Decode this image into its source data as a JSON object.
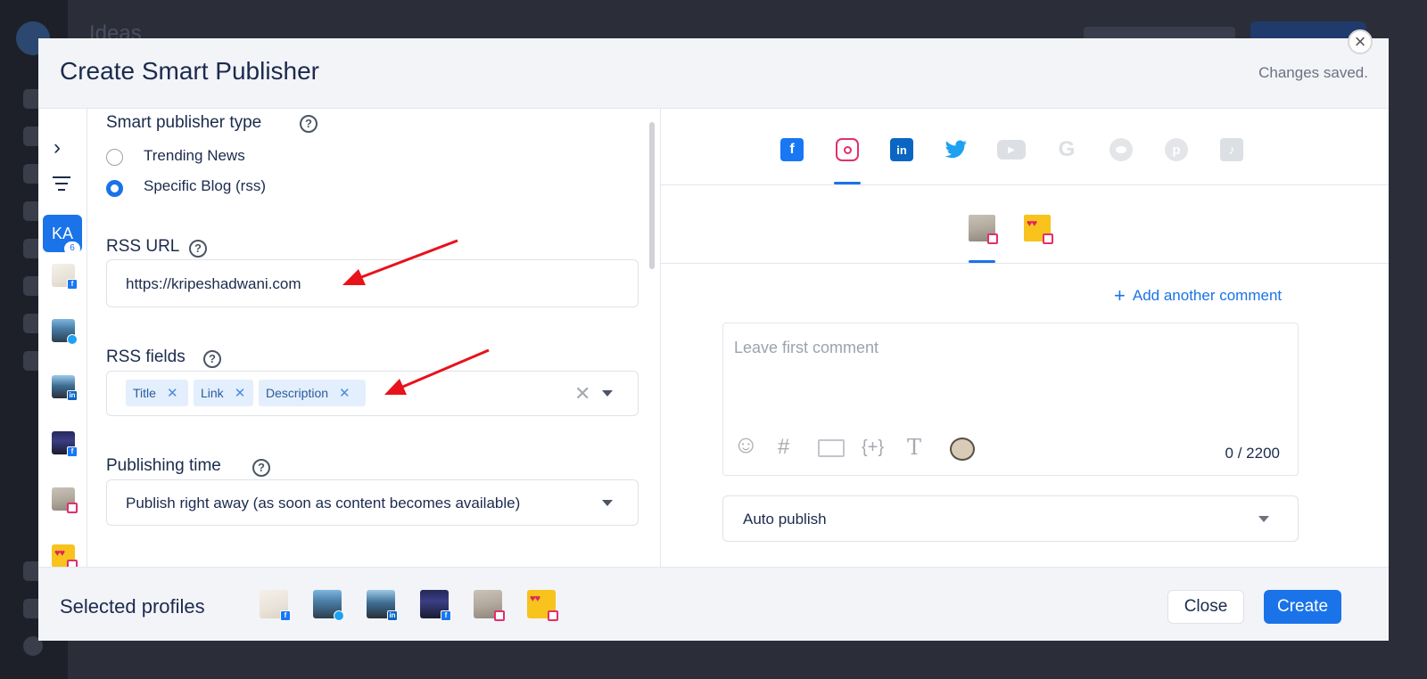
{
  "background": {
    "page_title": "Ideas"
  },
  "modal": {
    "title": "Create Smart Publisher",
    "status": "Changes saved.",
    "close_icon": "×"
  },
  "rail": {
    "chevron": "›",
    "workspace_initials": "KA",
    "workspace_count": "6",
    "profiles": [
      {
        "image": "doc",
        "platform": "facebook"
      },
      {
        "image": "man1",
        "platform": "twitter"
      },
      {
        "image": "man2",
        "platform": "linkedin"
      },
      {
        "image": "man3",
        "platform": "facebook"
      },
      {
        "image": "note",
        "platform": "instagram"
      },
      {
        "image": "emoji",
        "platform": "instagram"
      }
    ]
  },
  "form": {
    "type_label": "Smart publisher type",
    "option_trending": "Trending News",
    "option_blog": "Specific Blog (rss)",
    "selected_option": "Specific Blog (rss)",
    "rss_url_label": "RSS URL",
    "rss_url_value": "https://kripeshadwani.com",
    "rss_fields_label": "RSS fields",
    "rss_fields": [
      "Title",
      "Link",
      "Description"
    ],
    "publishing_time_label": "Publishing time",
    "publishing_time_value": "Publish right away (as soon as content becomes available)",
    "help_glyph": "?"
  },
  "right": {
    "platform_tabs": [
      "facebook",
      "instagram",
      "linkedin",
      "twitter",
      "youtube",
      "google",
      "reddit",
      "pinterest",
      "tiktok"
    ],
    "active_platform": "instagram",
    "add_comment": "Add another comment",
    "comment_placeholder": "Leave first comment",
    "counter": "0 / 2200",
    "publish_mode": "Auto publish",
    "toolbar_glyphs": {
      "emoji": "☺",
      "hashtag": "#",
      "text": "T",
      "variables": "{+}"
    }
  },
  "footer": {
    "selected_profiles_label": "Selected profiles",
    "close_button": "Close",
    "create_button": "Create"
  },
  "colors": {
    "accent": "#1a73e8",
    "facebook": "#1877f2",
    "instagram": "#e1306c",
    "linkedin": "#0a66c2",
    "twitter": "#1da1f2",
    "annotation_arrow": "#e8121b"
  }
}
